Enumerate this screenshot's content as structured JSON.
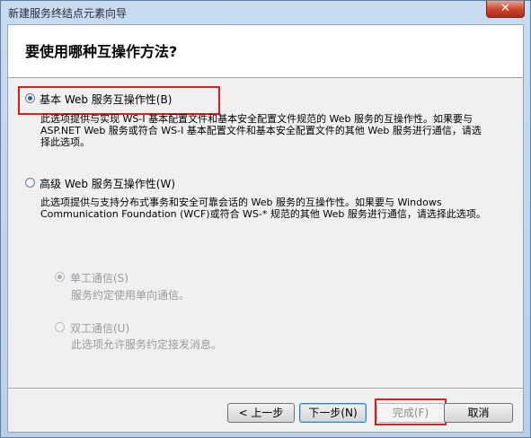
{
  "window": {
    "title": "新建服务终结点元素向导",
    "close_glyph": "✕"
  },
  "header": {
    "question": "要使用哪种互操作方法?"
  },
  "options": {
    "basic": {
      "label": "基本 Web 服务互操作性(B)",
      "selected": true,
      "desc_lines": [
        "此选项提供与实现 WS-I 基本配置文件和基本安全配置文件规范的 Web 服务的互操作性。如果要与",
        "ASP.NET Web 服务或符合 WS-I 基本配置文件和基本安全配置文件的其他 Web 服务进行通信，请选",
        "择此选项。"
      ]
    },
    "advanced": {
      "label": "高级 Web 服务互操作性(W)",
      "selected": false,
      "desc_lines": [
        "此选项提供与支持分布式事务和安全可靠会话的 Web 服务的互操作性。如果要与 Windows",
        "Communication Foundation (WCF)或符合 WS-* 规范的其他 Web 服务进行通信，请选择此选项。"
      ]
    },
    "simplex": {
      "label": "单工通信(S)",
      "desc": "服务约定使用单向通信。",
      "selected": true,
      "enabled": false
    },
    "duplex": {
      "label": "双工通信(U)",
      "desc": "此选项允许服务约定接发消息。",
      "selected": false,
      "enabled": false
    }
  },
  "buttons": {
    "back": "< 上一步",
    "next": "下一步(N)",
    "finish": "完成(F)",
    "cancel": "取消"
  },
  "colors": {
    "highlight": "#d42020",
    "radio_dot": "#2a5c9a"
  }
}
